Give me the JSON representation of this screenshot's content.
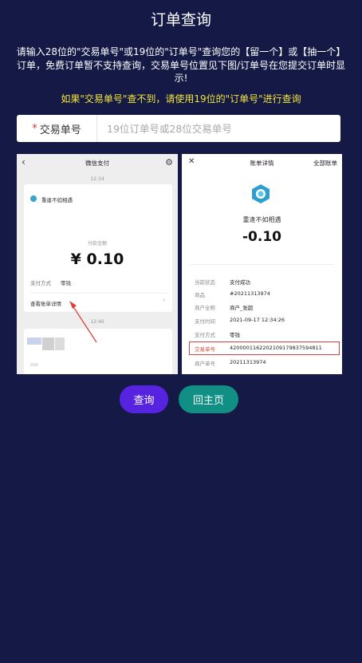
{
  "header": {
    "title": "订单查询"
  },
  "notice": {
    "text": "请输入28位的\"交易单号\"或19位的\"订单号\"查询您的【留一个】或【抽一个】订单，免费订单暂不支持查询，交易单号位置见下图/订单号在您提交订单时显示!",
    "tip": "如果\"交易单号\"查不到，请使用19位的\"订单号\"进行查询"
  },
  "form": {
    "required_mark": "*",
    "label": "交易单号",
    "value": "",
    "placeholder": "19位订单号或28位交易单号"
  },
  "guide": {
    "left": {
      "title": "微信支付",
      "time1": "12:34",
      "merchant": "重逢不如相遇",
      "amount_label": "付款金额",
      "amount": "¥ 0.10",
      "pay_method_key": "支付方式",
      "pay_method_value": "零钱",
      "detail_link": "查看账单详情",
      "time2": "12:46"
    },
    "right": {
      "title": "账单详情",
      "all_bills": "全部账单",
      "merchant": "重逢不如相遇",
      "amount": "-0.10",
      "rows": [
        {
          "k": "当前状态",
          "v": "支付成功"
        },
        {
          "k": "商品",
          "v": "#20211313974"
        },
        {
          "k": "商户全称",
          "v": "商户_张超"
        },
        {
          "k": "支付时间",
          "v": "2021-09-17 12:34:26"
        },
        {
          "k": "支付方式",
          "v": "零钱"
        },
        {
          "k": "交易单号",
          "v": "4200001162202109179837594811"
        },
        {
          "k": "商户单号",
          "v": "20211313974"
        }
      ]
    }
  },
  "buttons": {
    "query": "查询",
    "home": "回主页"
  },
  "colors": {
    "background": "#141a45",
    "tip": "#f2e43a",
    "query_button": "#5623e0",
    "home_button": "#118f84",
    "highlight_box": "#d9443a"
  }
}
